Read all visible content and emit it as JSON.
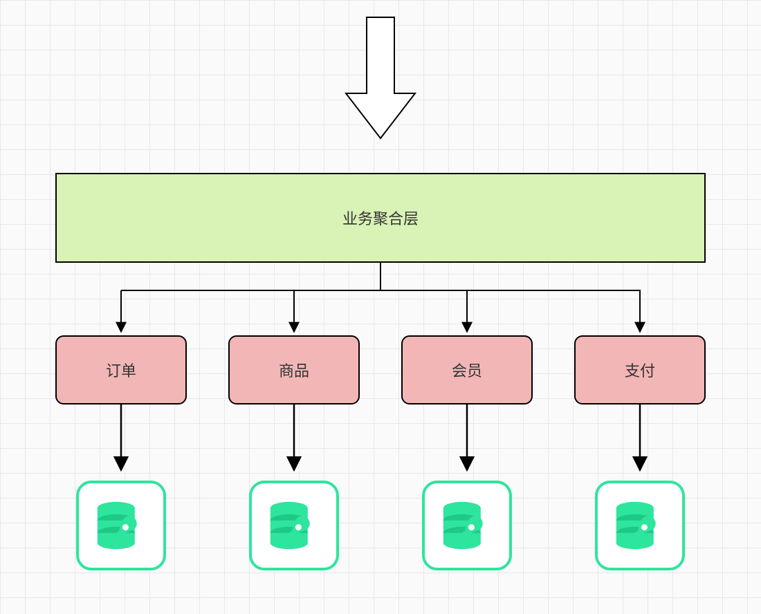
{
  "layers": {
    "aggregation": {
      "label": "业务聚合层"
    }
  },
  "services": [
    {
      "label": "订单"
    },
    {
      "label": "商品"
    },
    {
      "label": "会员"
    },
    {
      "label": "支付"
    }
  ],
  "colors": {
    "aggregation_fill": "#d9f2b6",
    "service_fill": "#f2b6b6",
    "db_accent": "#2ee59d",
    "stroke": "#000000"
  }
}
